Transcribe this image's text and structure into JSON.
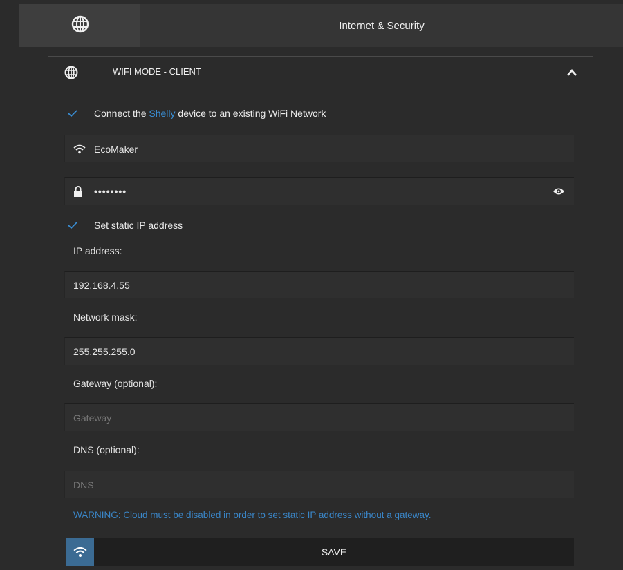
{
  "header": {
    "title": "Internet & Security",
    "icon": "globe-icon"
  },
  "section": {
    "title": "WIFI MODE - CLIENT",
    "icon": "globe-icon",
    "collapse_icon": "chevron-up-icon"
  },
  "connect": {
    "checked": true,
    "label_prefix": "Connect the ",
    "label_brand": "Shelly",
    "label_suffix": " device to an existing WiFi Network"
  },
  "ssid": {
    "icon": "wifi-icon",
    "value": "EcoMaker"
  },
  "password": {
    "icon": "lock-icon",
    "masked_value": "••••••••",
    "toggle_icon": "eye-icon"
  },
  "static_ip": {
    "checked": true,
    "label": "Set static IP address"
  },
  "ip": {
    "label": "IP address:",
    "value": "192.168.4.55"
  },
  "mask": {
    "label": "Network mask:",
    "value": "255.255.255.0"
  },
  "gateway": {
    "label": "Gateway (optional):",
    "placeholder": "Gateway",
    "value": ""
  },
  "dns": {
    "label": "DNS (optional):",
    "placeholder": "DNS",
    "value": ""
  },
  "warning": "WARNING: Cloud must be disabled in order to set static IP address without a gateway.",
  "save": {
    "label": "SAVE",
    "icon": "wifi-icon"
  },
  "colors": {
    "background": "#2b2b2b",
    "accent": "#3a8fd6",
    "save_icon_bg": "#3b6b93"
  }
}
